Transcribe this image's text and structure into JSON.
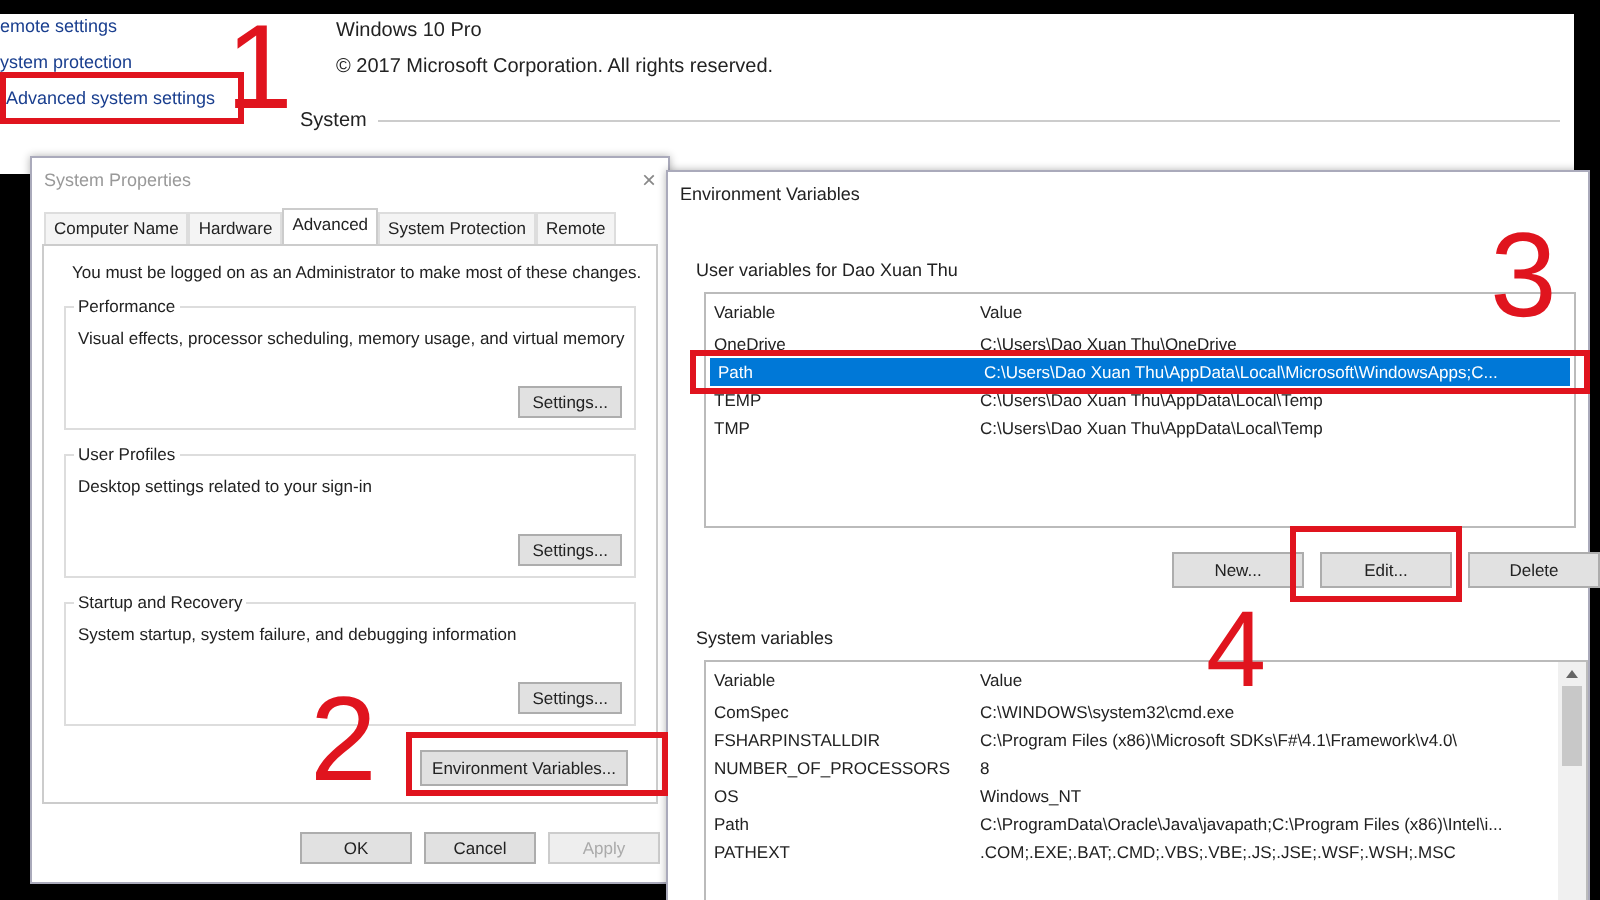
{
  "control_panel": {
    "links": [
      "emote settings",
      "ystem protection",
      "Advanced system settings"
    ],
    "edition": "Windows 10 Pro",
    "copyright": "© 2017 Microsoft Corporation. All rights reserved.",
    "section": "System"
  },
  "system_properties": {
    "title": "System Properties",
    "close": "×",
    "tabs": [
      {
        "label": "Computer Name",
        "selected": false
      },
      {
        "label": "Hardware",
        "selected": false
      },
      {
        "label": "Advanced",
        "selected": true
      },
      {
        "label": "System Protection",
        "selected": false
      },
      {
        "label": "Remote",
        "selected": false
      }
    ],
    "notice": "You must be logged on as an Administrator to make most of these changes.",
    "groups": [
      {
        "title": "Performance",
        "description": "Visual effects, processor scheduling, memory usage, and virtual memory",
        "button": "Settings..."
      },
      {
        "title": "User Profiles",
        "description": "Desktop settings related to your sign-in",
        "button": "Settings..."
      },
      {
        "title": "Startup and Recovery",
        "description": "System startup, system failure, and debugging information",
        "button": "Settings..."
      }
    ],
    "env_button": "Environment Variables...",
    "buttons": [
      {
        "label": "OK",
        "disabled": false
      },
      {
        "label": "Cancel",
        "disabled": false
      },
      {
        "label": "Apply",
        "disabled": true
      }
    ]
  },
  "environment_variables": {
    "title": "Environment Variables",
    "user_group": "User variables for Dao Xuan Thu",
    "user_columns": [
      "Variable",
      "Value"
    ],
    "user_rows": [
      {
        "variable": "OneDrive",
        "value": "C:\\Users\\Dao Xuan Thu\\OneDrive",
        "selected": false
      },
      {
        "variable": "Path",
        "value": "C:\\Users\\Dao Xuan Thu\\AppData\\Local\\Microsoft\\WindowsApps;C...",
        "selected": true
      },
      {
        "variable": "TEMP",
        "value": "C:\\Users\\Dao Xuan Thu\\AppData\\Local\\Temp",
        "selected": false
      },
      {
        "variable": "TMP",
        "value": "C:\\Users\\Dao Xuan Thu\\AppData\\Local\\Temp",
        "selected": false
      }
    ],
    "user_buttons": [
      "New...",
      "Edit...",
      "Delete"
    ],
    "system_group": "System variables",
    "system_columns": [
      "Variable",
      "Value"
    ],
    "system_rows": [
      {
        "variable": "ComSpec",
        "value": "C:\\WINDOWS\\system32\\cmd.exe",
        "selected": false
      },
      {
        "variable": "FSHARPINSTALLDIR",
        "value": "C:\\Program Files (x86)\\Microsoft SDKs\\F#\\4.1\\Framework\\v4.0\\",
        "selected": false
      },
      {
        "variable": "NUMBER_OF_PROCESSORS",
        "value": "8",
        "selected": false
      },
      {
        "variable": "OS",
        "value": "Windows_NT",
        "selected": false
      },
      {
        "variable": "Path",
        "value": "C:\\ProgramData\\Oracle\\Java\\javapath;C:\\Program Files (x86)\\Intel\\i...",
        "selected": false
      },
      {
        "variable": "PATHEXT",
        "value": ".COM;.EXE;.BAT;.CMD;.VBS;.VBE;.JS;.JSE;.WSF;.WSH;.MSC",
        "selected": false
      }
    ]
  },
  "annotations": [
    {
      "label": "1"
    },
    {
      "label": "2"
    },
    {
      "label": "3"
    },
    {
      "label": "4"
    }
  ]
}
